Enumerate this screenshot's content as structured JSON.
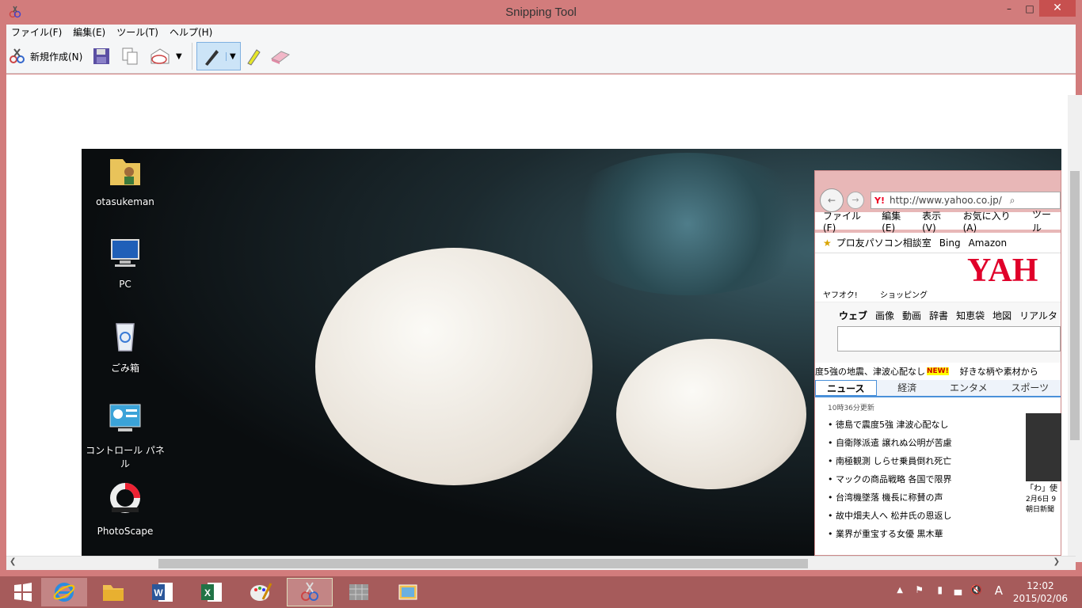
{
  "window": {
    "title": "Snipping Tool"
  },
  "menu": {
    "file": "ファイル(F)",
    "edit": "編集(E)",
    "tools": "ツール(T)",
    "help": "ヘルプ(H)"
  },
  "toolbar": {
    "new_label": "新規作成(N)"
  },
  "desktop_icons": [
    {
      "label": "otasukeman",
      "icon": "user-folder-icon"
    },
    {
      "label": "PC",
      "icon": "computer-icon"
    },
    {
      "label": "ごみ箱",
      "icon": "recycle-bin-icon"
    },
    {
      "label": "コントロール パネル",
      "icon": "control-panel-icon"
    },
    {
      "label": "PhotoScape",
      "icon": "photoscape-icon"
    }
  ],
  "ie": {
    "url": "http://www.yahoo.co.jp/",
    "menu": [
      "ファイル(F)",
      "編集(E)",
      "表示(V)",
      "お気に入り(A)",
      "ツール"
    ],
    "favorites": [
      "プロ友パソコン相談室",
      "Bing",
      "Amazon"
    ],
    "services": [
      "ヤフオク!",
      "ショッピング"
    ],
    "logo": "YAH",
    "search_tabs": [
      "ウェブ",
      "画像",
      "動画",
      "辞書",
      "知恵袋",
      "地図",
      "リアルタ"
    ],
    "ticker_left": "度5強の地震、津波心配なし",
    "ticker_right": "好きな柄や素材から",
    "new_badge": "NEW!",
    "news_tabs": [
      "ニュース",
      "経済",
      "エンタメ",
      "スポーツ"
    ],
    "updated": "10時36分更新",
    "news": [
      "徳島で震度5強 津波心配なし",
      "自衛隊派遣 譲れぬ公明が苦慮",
      "南極観測 しらせ乗員倒れ死亡",
      "マックの商品戦略 各国で限界",
      "台湾機墜落 機長に称賛の声",
      "故中畑夫人へ 松井氏の恩返し",
      "業界が重宝する女優 黒木華"
    ],
    "side_caption": "「わ」使",
    "side_date": "2月6日 9",
    "side_source": "朝日新聞"
  },
  "clock": {
    "time": "12:02",
    "date": "2015/02/06"
  },
  "tray": {
    "ime": "A"
  }
}
